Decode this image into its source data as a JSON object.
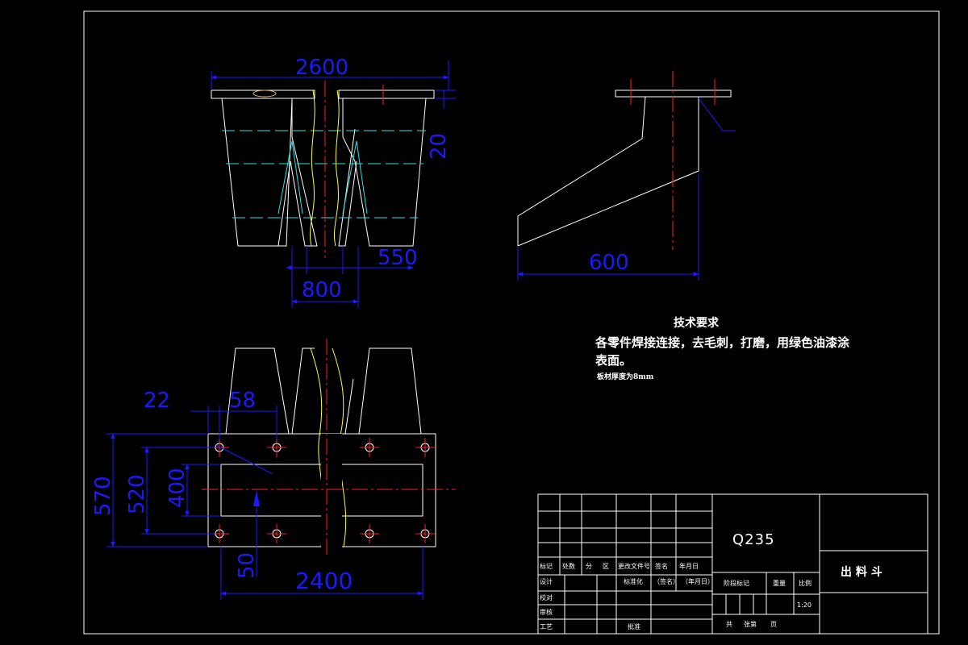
{
  "drawing": {
    "colors": {
      "background": "#000000",
      "outline": "#ffffff",
      "dimension": "#1a1aff",
      "centerline": "#ff2020",
      "hidden": "#30e0e0",
      "break": "#ffff40"
    },
    "dimensions": {
      "top_width": "2600",
      "flange_thickness": "20",
      "bottom_gap": "550",
      "bottom_span": "800",
      "side_depth": "600",
      "plan_hole_offset": "22",
      "plan_hole_pitch": "58",
      "plan_outer_height": "570",
      "plan_hole_height": "520",
      "plan_inner_height": "400",
      "plan_edge_offset": "50",
      "plan_length": "2400"
    },
    "technical_requirements": {
      "title": "技术要求",
      "line1": "各零件焊接连接，去毛刺，打磨，用绿色油漆涂",
      "line2": "表面。",
      "line3": "板材厚度为8mm"
    },
    "title_block": {
      "material": "Q235",
      "part_name": "出 料 斗",
      "row_labels": {
        "mark": "标记",
        "count": "处数",
        "zone": "分",
        "zone2": "区",
        "change_doc": "更改文件号",
        "sign": "签名",
        "date": "年月日",
        "design": "设计",
        "standardize": "标准化",
        "sign_paren": "（签名）",
        "date_paren": "（年月日）",
        "stage_mark": "阶段标记",
        "weight": "重量",
        "scale": "比例",
        "proofread": "校对",
        "review": "审核",
        "process": "工艺",
        "approve": "批准",
        "total": "共",
        "sheets": "张第",
        "page": "页",
        "scale_value": "1:20"
      }
    }
  }
}
